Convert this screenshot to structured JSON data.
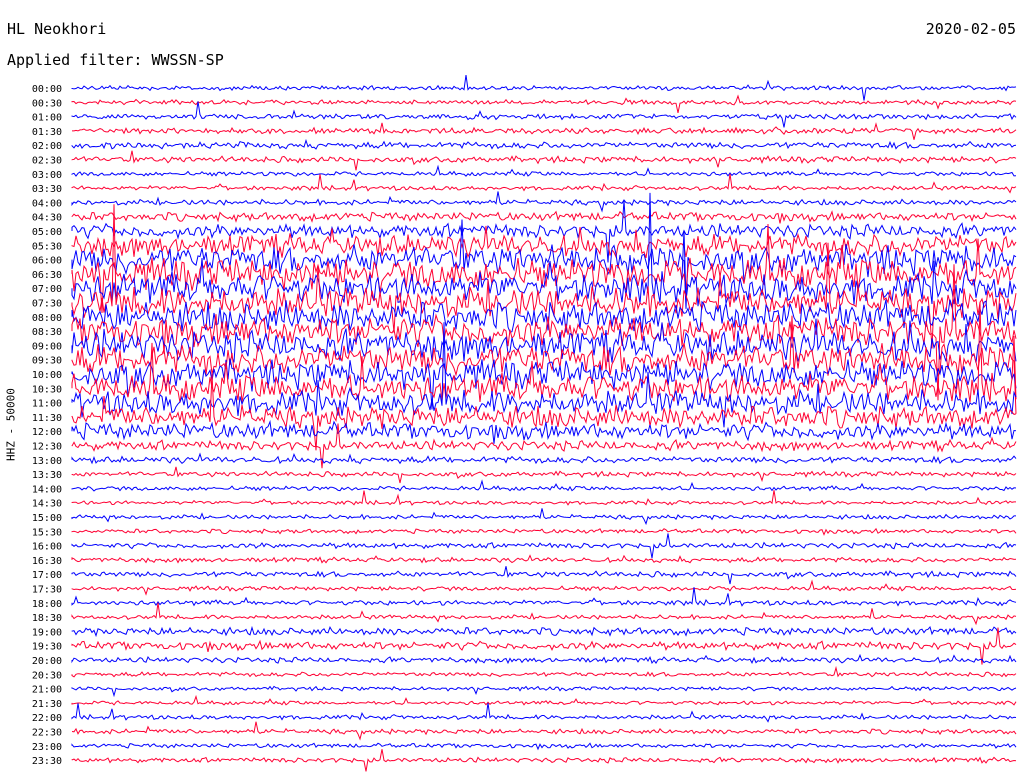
{
  "header": {
    "station": "HL Neokhori",
    "date": "2020-02-05",
    "filter": "Applied filter: WWSSN-SP",
    "channel_scale": "HHZ - 50000"
  },
  "colors": {
    "even_trace": "#0000ff",
    "odd_trace": "#ff0033",
    "background": "#ffffff"
  },
  "chart_data": {
    "type": "line",
    "title": "HL Neokhori",
    "subtitle": "Applied filter: WWSSN-SP",
    "ylabel": "HHZ - 50000",
    "grid": false,
    "series_colors_alternate": [
      "blue",
      "red"
    ],
    "rows": [
      {
        "label": "00:00",
        "amplitude": 0.8
      },
      {
        "label": "00:30",
        "amplitude": 0.8
      },
      {
        "label": "01:00",
        "amplitude": 0.9
      },
      {
        "label": "01:30",
        "amplitude": 1.0
      },
      {
        "label": "02:00",
        "amplitude": 1.2
      },
      {
        "label": "02:30",
        "amplitude": 1.1
      },
      {
        "label": "03:00",
        "amplitude": 0.8
      },
      {
        "label": "03:30",
        "amplitude": 0.8
      },
      {
        "label": "04:00",
        "amplitude": 1.0
      },
      {
        "label": "04:30",
        "amplitude": 1.6
      },
      {
        "label": "05:00",
        "amplitude": 2.5
      },
      {
        "label": "05:30",
        "amplitude": 4.0
      },
      {
        "label": "06:00",
        "amplitude": 5.0
      },
      {
        "label": "06:30",
        "amplitude": 5.5
      },
      {
        "label": "07:00",
        "amplitude": 5.5
      },
      {
        "label": "07:30",
        "amplitude": 5.5
      },
      {
        "label": "08:00",
        "amplitude": 5.5
      },
      {
        "label": "08:30",
        "amplitude": 5.5
      },
      {
        "label": "09:00",
        "amplitude": 5.5
      },
      {
        "label": "09:30",
        "amplitude": 5.5
      },
      {
        "label": "10:00",
        "amplitude": 5.0
      },
      {
        "label": "10:30",
        "amplitude": 5.0
      },
      {
        "label": "11:00",
        "amplitude": 4.5
      },
      {
        "label": "11:30",
        "amplitude": 4.0
      },
      {
        "label": "12:00",
        "amplitude": 3.0
      },
      {
        "label": "12:30",
        "amplitude": 1.8
      },
      {
        "label": "13:00",
        "amplitude": 1.2
      },
      {
        "label": "13:30",
        "amplitude": 0.9
      },
      {
        "label": "14:00",
        "amplitude": 0.8
      },
      {
        "label": "14:30",
        "amplitude": 0.7
      },
      {
        "label": "15:00",
        "amplitude": 0.8
      },
      {
        "label": "15:30",
        "amplitude": 0.8
      },
      {
        "label": "16:00",
        "amplitude": 1.0
      },
      {
        "label": "16:30",
        "amplitude": 0.9
      },
      {
        "label": "17:00",
        "amplitude": 1.0
      },
      {
        "label": "17:30",
        "amplitude": 0.8
      },
      {
        "label": "18:00",
        "amplitude": 0.9
      },
      {
        "label": "18:30",
        "amplitude": 0.8
      },
      {
        "label": "19:00",
        "amplitude": 1.4
      },
      {
        "label": "19:30",
        "amplitude": 1.5
      },
      {
        "label": "20:00",
        "amplitude": 1.0
      },
      {
        "label": "20:30",
        "amplitude": 0.8
      },
      {
        "label": "21:00",
        "amplitude": 0.7
      },
      {
        "label": "21:30",
        "amplitude": 0.7
      },
      {
        "label": "22:00",
        "amplitude": 0.8
      },
      {
        "label": "22:30",
        "amplitude": 0.9
      },
      {
        "label": "23:00",
        "amplitude": 0.8
      },
      {
        "label": "23:30",
        "amplitude": 0.9
      }
    ]
  }
}
